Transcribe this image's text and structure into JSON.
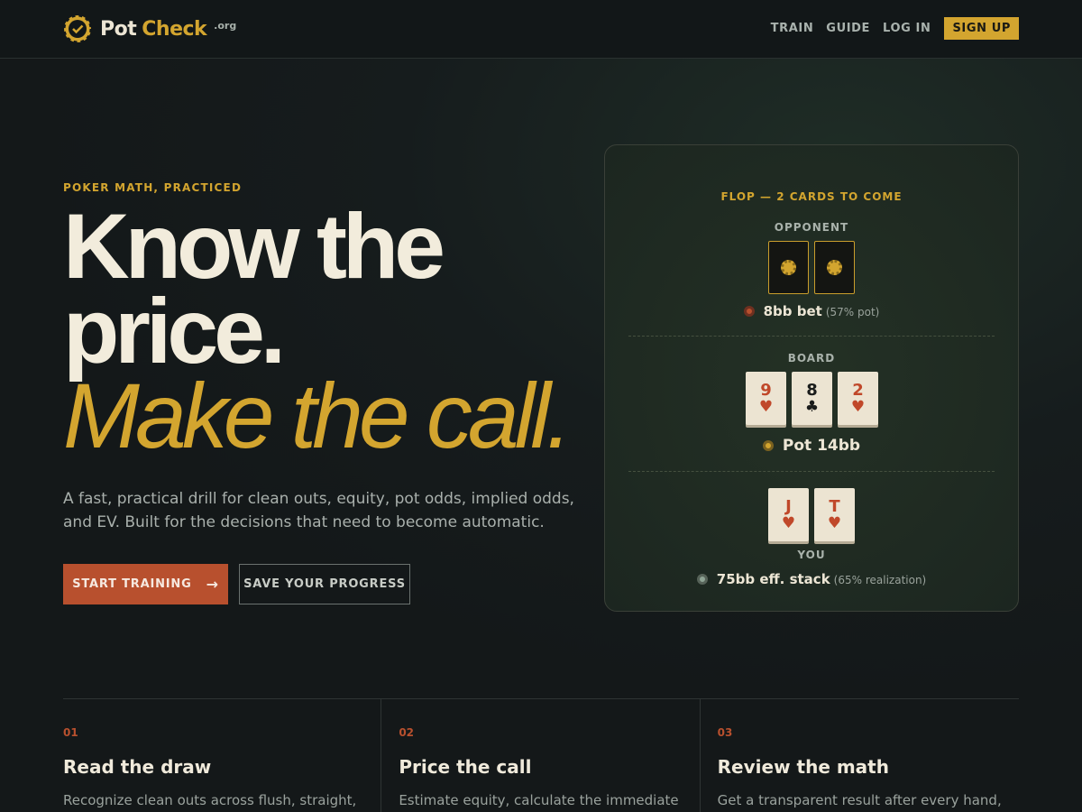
{
  "header": {
    "logo": {
      "pot": "Pot",
      "check": "Check",
      "tld": ".org"
    },
    "nav": [
      {
        "label": "TRAIN"
      },
      {
        "label": "GUIDE"
      },
      {
        "label": "LOG IN"
      }
    ],
    "signup_label": "SIGN UP"
  },
  "hero": {
    "eyebrow": "POKER MATH, PRACTICED",
    "headline_line1": "Know the",
    "headline_line2": "price.",
    "headline_italic": "Make the call.",
    "lede": "A fast, practical drill for clean outs, equity, pot odds, implied odds, and EV. Built for the decisions that need to become automatic.",
    "primary_button": "START TRAINING",
    "primary_arrow": "→",
    "secondary_button": "SAVE YOUR PROGRESS"
  },
  "table_card": {
    "street_label": "FLOP — 2 CARDS TO COME",
    "opponent_label": "OPPONENT",
    "opponent_bet": "8bb bet",
    "opponent_bet_note": "(57% pot)",
    "board_label": "BOARD",
    "board": [
      {
        "rank": "9",
        "suit": "♥",
        "color": "red"
      },
      {
        "rank": "8",
        "suit": "♣",
        "color": "black"
      },
      {
        "rank": "2",
        "suit": "♥",
        "color": "red"
      }
    ],
    "pot": "Pot 14bb",
    "hero_cards": [
      {
        "rank": "J",
        "suit": "♥",
        "color": "red"
      },
      {
        "rank": "T",
        "suit": "♥",
        "color": "red"
      }
    ],
    "you_label": "YOU",
    "stack": "75bb eff. stack",
    "stack_note": "(65% realization)"
  },
  "features": [
    {
      "num": "01",
      "title": "Read the draw",
      "desc": "Recognize clean outs across flush, straight,"
    },
    {
      "num": "02",
      "title": "Price the call",
      "desc": "Estimate equity, calculate the immediate"
    },
    {
      "num": "03",
      "title": "Review the math",
      "desc": "Get a transparent result after every hand,"
    }
  ],
  "colors": {
    "gold": "#d3a52f",
    "rust": "#b8502e",
    "cream": "#f2ecdc",
    "background": "#161c1d"
  }
}
